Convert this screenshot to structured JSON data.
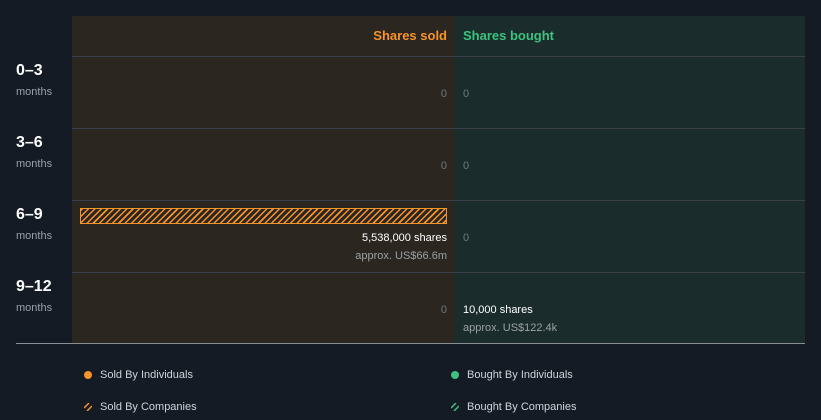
{
  "chart_data": {
    "type": "bar",
    "orientation": "horizontal",
    "columns": [
      "Shares sold",
      "Shares bought"
    ],
    "categories": [
      {
        "period": "0–3",
        "unit": "months"
      },
      {
        "period": "3–6",
        "unit": "months"
      },
      {
        "period": "6–9",
        "unit": "months"
      },
      {
        "period": "9–12",
        "unit": "months"
      }
    ],
    "series": [
      {
        "name": "Sold By Individuals",
        "values": [
          0,
          0,
          0,
          0
        ],
        "color": "#f6932a"
      },
      {
        "name": "Sold By Companies",
        "values": [
          0,
          0,
          5538000,
          0
        ],
        "color": "#f6932a"
      },
      {
        "name": "Bought By Individuals",
        "values": [
          0,
          0,
          0,
          0
        ],
        "color": "#3cc27e"
      },
      {
        "name": "Bought By Companies",
        "values": [
          0,
          0,
          0,
          10000
        ],
        "color": "#3cc27e"
      }
    ],
    "sold": [
      {
        "shares": "0",
        "approx": ""
      },
      {
        "shares": "0",
        "approx": ""
      },
      {
        "shares": "5,538,000 shares",
        "approx": "approx. US$66.6m"
      },
      {
        "shares": "0",
        "approx": ""
      }
    ],
    "bought": [
      {
        "shares": "0",
        "approx": ""
      },
      {
        "shares": "0",
        "approx": ""
      },
      {
        "shares": "0",
        "approx": ""
      },
      {
        "shares": "10,000 shares",
        "approx": "approx. US$122.4k"
      }
    ],
    "legend": [
      "Sold By Individuals",
      "Bought By Individuals",
      "Sold By Companies",
      "Bought By Companies"
    ]
  }
}
